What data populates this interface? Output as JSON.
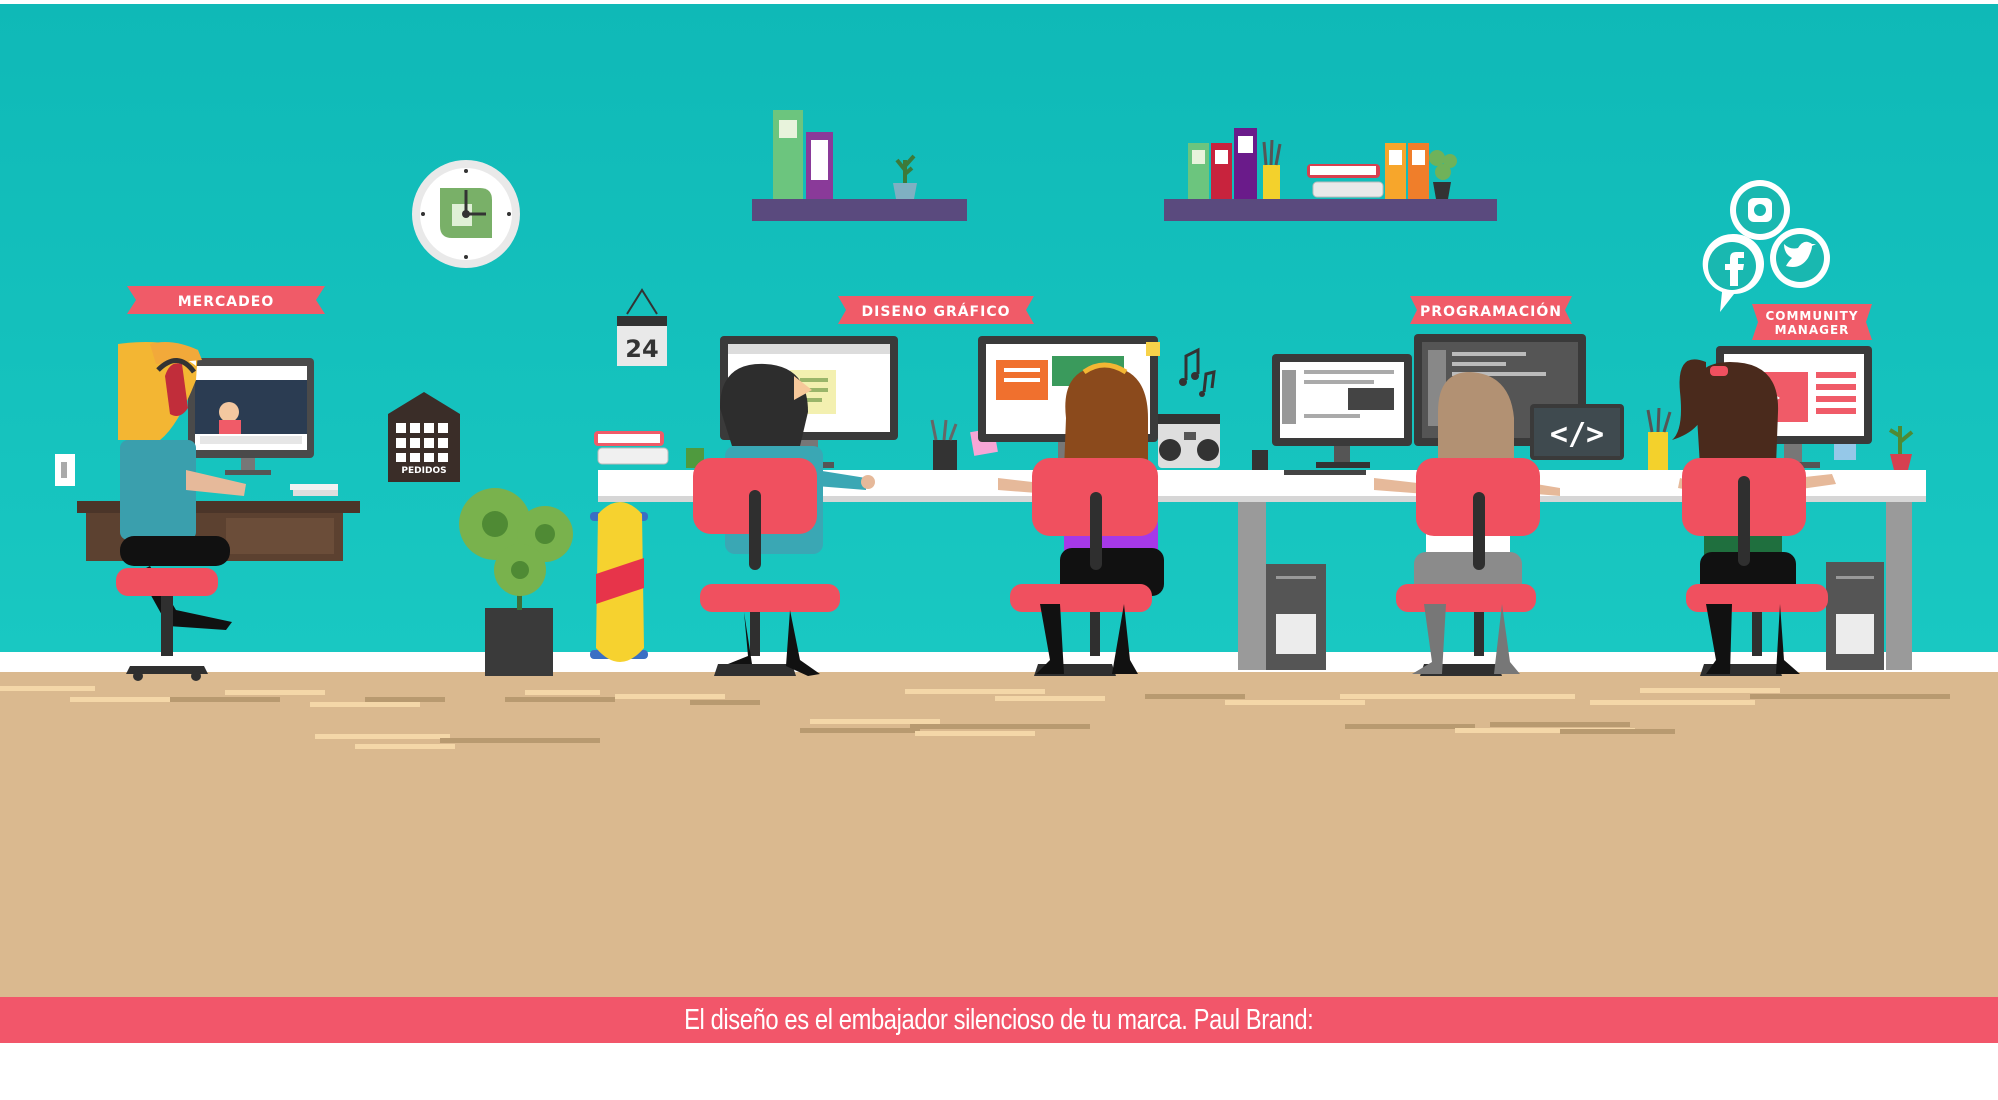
{
  "labels": {
    "mercadeo": "MERCADEO",
    "diseno": "DISENO GRÁFICO",
    "programacion": "PROGRAMACIÓN",
    "community_line1": "COMMUNITY",
    "community_line2": "MANAGER",
    "pedidos": "PEDIDOS",
    "calendar_day": "24",
    "code_symbol": "</>"
  },
  "caption": "El diseño es el embajador silencioso de tu marca. Paul Brand:",
  "colors": {
    "wall": "#17c3bc",
    "floor": "#dab98f",
    "accent": "#f2566a",
    "shelf": "#5a4a7e",
    "chair": "#f0505f"
  },
  "icons": [
    "clock-icon",
    "instagram-icon",
    "facebook-icon",
    "twitter-icon",
    "music-note-icon"
  ]
}
